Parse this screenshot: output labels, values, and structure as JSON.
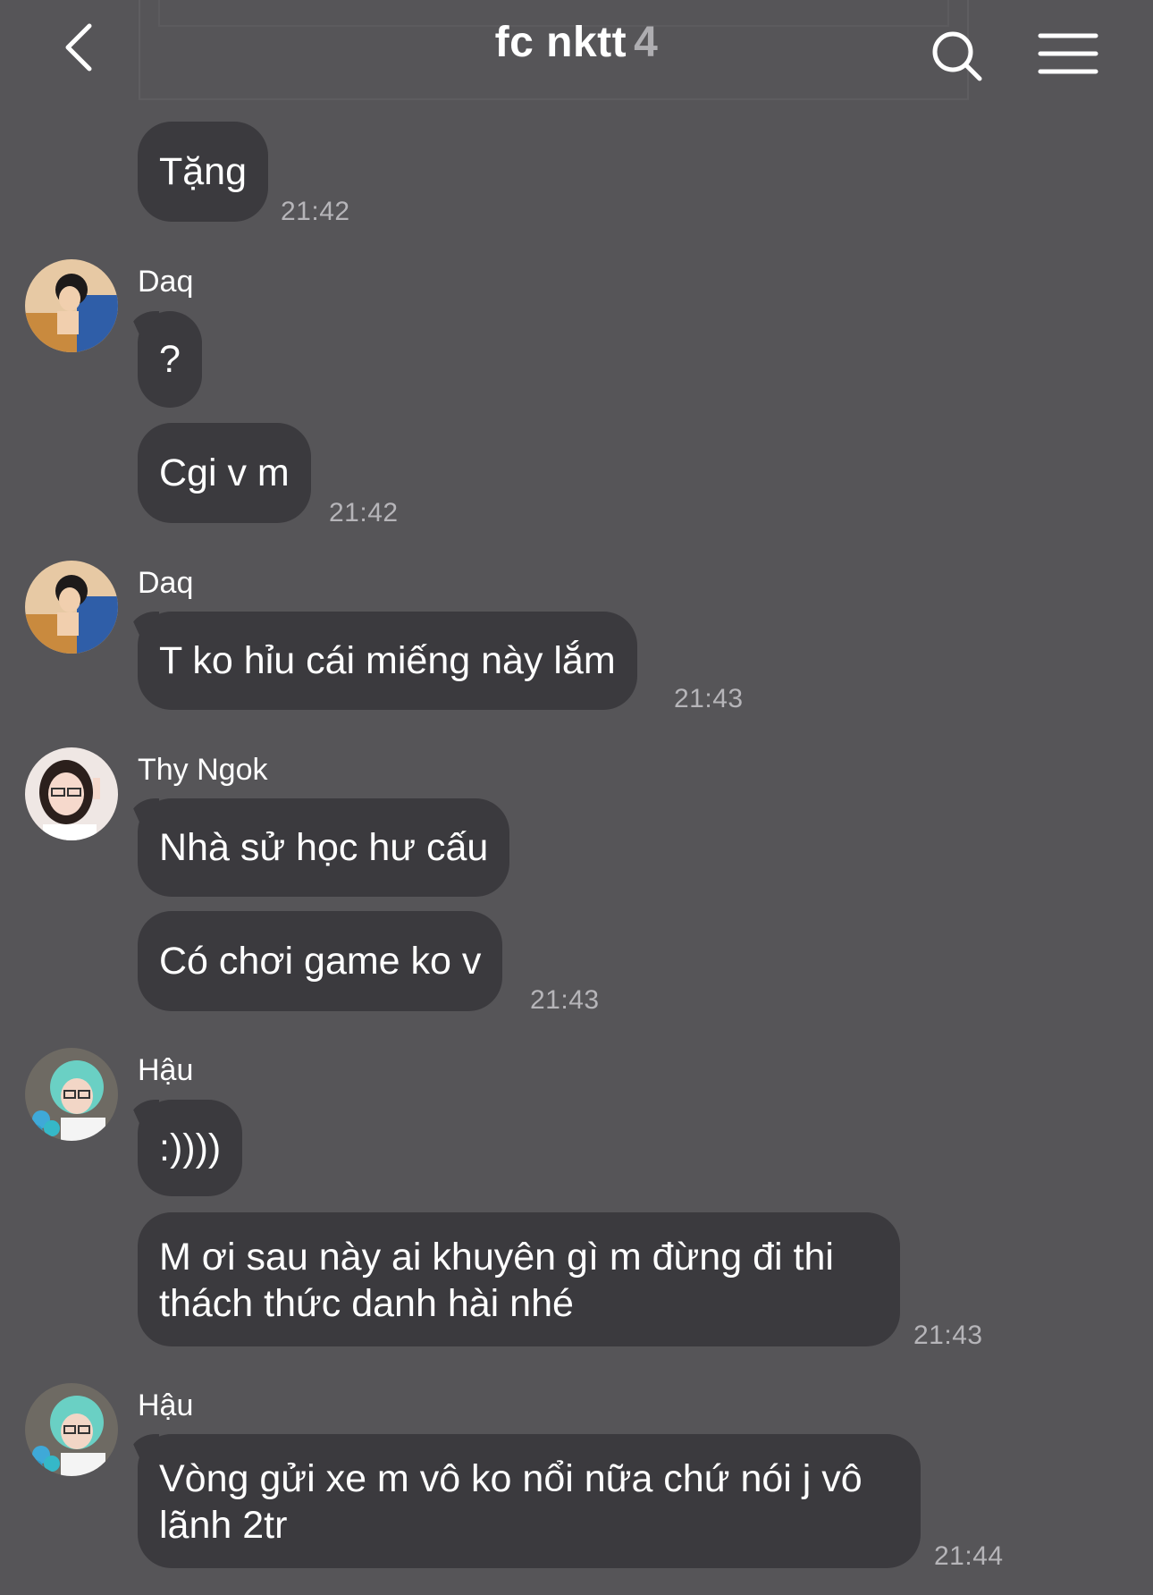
{
  "header": {
    "title": "fc nktt",
    "member_count": "4"
  },
  "messages": [
    {
      "type": "text",
      "text": "Tặng",
      "time": "21:42"
    },
    {
      "type": "sender",
      "name": "Daq"
    },
    {
      "type": "text",
      "text": "?"
    },
    {
      "type": "text",
      "text": "Cgi v m",
      "time": "21:42"
    },
    {
      "type": "sender",
      "name": "Daq"
    },
    {
      "type": "text",
      "text": "T ko hỉu cái miếng này lắm",
      "time": "21:43"
    },
    {
      "type": "sender",
      "name": "Thy Ngok"
    },
    {
      "type": "text",
      "text": "Nhà sử học hư cấu"
    },
    {
      "type": "text",
      "text": "Có chơi game ko v",
      "time": "21:43"
    },
    {
      "type": "sender",
      "name": "Hậu"
    },
    {
      "type": "text",
      "text": ":))))"
    },
    {
      "type": "text",
      "text": "M ơi sau này ai khuyên gì m đừng đi thi thách thức danh hài nhé",
      "time": "21:43"
    },
    {
      "type": "sender",
      "name": "Hậu"
    },
    {
      "type": "text",
      "text": "Vòng gửi xe m vô ko nổi nữa chứ nói j vô lãnh 2tr",
      "time": "21:44"
    }
  ],
  "icons": {
    "back": "chevron-left-icon",
    "search": "search-icon",
    "menu": "hamburger-menu-icon"
  },
  "colors": {
    "background": "#565558",
    "bubble": "#3b3a3e",
    "timestamp": "#b6b5b9",
    "member_count": "#aeadb1"
  }
}
